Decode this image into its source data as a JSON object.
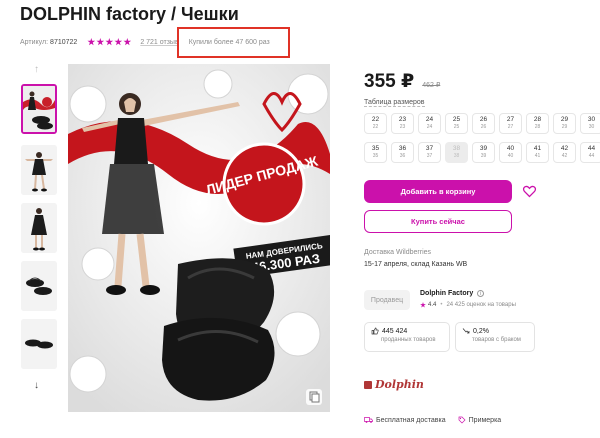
{
  "product": {
    "title": "DOLPHIN factory / Чешки",
    "sku_label": "Артикул:",
    "sku_value": "8710722",
    "rating_stars": 5,
    "reviews": "2 721 отзыв",
    "bought": "Купили более 47 600 раз"
  },
  "gallery": {
    "nav_up_icon": "chevron-up-icon",
    "nav_down_icon": "arrow-down-icon",
    "thumbnail_count": 5,
    "main_image": {
      "badge_text": "ЛИДЕР ПРОДАЖ",
      "sticker_top": "НАМ ДОВЕРИЛИСЬ",
      "sticker_bottom": "46.300 РАЗ"
    }
  },
  "pricing": {
    "price": "355 ₽",
    "old_price": "462 ₽"
  },
  "sizes": {
    "title": "Таблица размеров",
    "items": [
      {
        "ru": "22",
        "eu": "22",
        "available": true
      },
      {
        "ru": "23",
        "eu": "23",
        "available": true
      },
      {
        "ru": "24",
        "eu": "24",
        "available": true
      },
      {
        "ru": "25",
        "eu": "25",
        "available": true
      },
      {
        "ru": "26",
        "eu": "26",
        "available": true
      },
      {
        "ru": "27",
        "eu": "27",
        "available": true
      },
      {
        "ru": "28",
        "eu": "28",
        "available": true
      },
      {
        "ru": "29",
        "eu": "29",
        "available": true
      },
      {
        "ru": "30",
        "eu": "30",
        "available": true
      },
      {
        "ru": "35",
        "eu": "35",
        "available": true
      },
      {
        "ru": "36",
        "eu": "36",
        "available": true
      },
      {
        "ru": "37",
        "eu": "37",
        "available": true
      },
      {
        "ru": "38",
        "eu": "38",
        "available": false
      },
      {
        "ru": "39",
        "eu": "39",
        "available": true
      },
      {
        "ru": "40",
        "eu": "40",
        "available": true
      },
      {
        "ru": "41",
        "eu": "41",
        "available": true
      },
      {
        "ru": "42",
        "eu": "42",
        "available": true
      },
      {
        "ru": "44",
        "eu": "44",
        "available": true
      }
    ]
  },
  "actions": {
    "add_to_cart": "Добавить в корзину",
    "buy_now": "Купить сейчас",
    "favorite_icon": "heart-icon"
  },
  "delivery": {
    "title": "Доставка Wildberries",
    "date": "15-17 апреля, склад Казань WB"
  },
  "seller": {
    "badge": "Продавец",
    "name": "Dolphin Factory",
    "rating": "4.4",
    "ratings_count": "24 425 оценок на товары"
  },
  "stats": {
    "sold_value": "445 424",
    "sold_label": "проданных товаров",
    "defect_value": "0,2%",
    "defect_label": "товаров с браком"
  },
  "brand": {
    "name": "Dolphin"
  },
  "features": {
    "free_delivery": "Бесплатная доставка",
    "try_on": "Примерка"
  },
  "colors": {
    "accent": "#cb11ab",
    "highlight_box": "#e03226",
    "brand": "#b03636"
  }
}
